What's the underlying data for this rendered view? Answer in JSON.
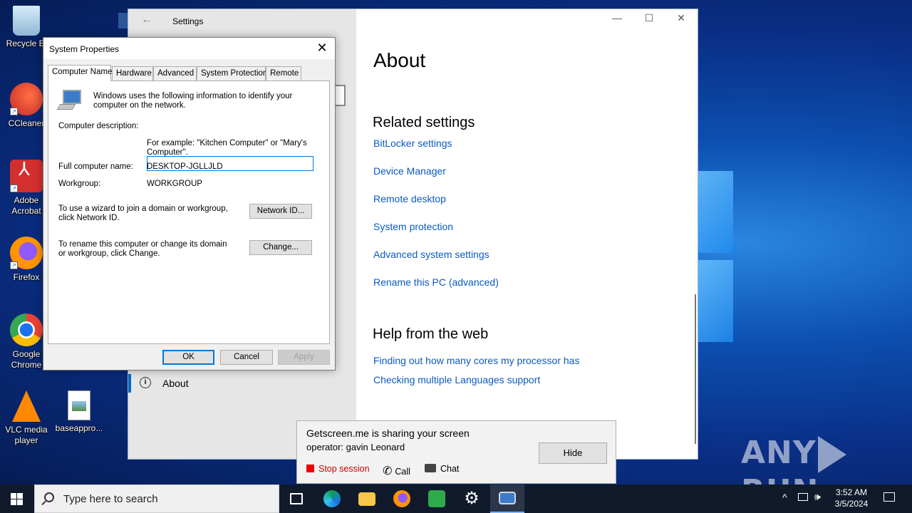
{
  "desktop": {
    "icons": [
      {
        "label": "Recycle Bi",
        "icon": "recycle-bin-icon"
      },
      {
        "label": "CCleaner",
        "icon": "ccleaner-icon"
      },
      {
        "label": "Adobe Acrobat",
        "icon": "adobe-acrobat-icon"
      },
      {
        "label": "Firefox",
        "icon": "firefox-icon"
      },
      {
        "label": "Google Chrome",
        "icon": "chrome-icon"
      },
      {
        "label": "VLC media player",
        "icon": "vlc-icon"
      },
      {
        "label": "baseappro...",
        "icon": "image-file-icon"
      }
    ],
    "watermark": "ANY RUN"
  },
  "settings": {
    "title": "Settings",
    "heading": "About",
    "related_heading": "Related settings",
    "related_links": [
      "BitLocker settings",
      "Device Manager",
      "Remote desktop",
      "System protection",
      "Advanced system settings",
      "Rename this PC (advanced)"
    ],
    "help_heading": "Help from the web",
    "help_links": [
      "Finding out how many cores my processor has",
      "Checking multiple Languages support"
    ],
    "nav_about": "About"
  },
  "sysprop": {
    "title": "System Properties",
    "tabs": [
      "Computer Name",
      "Hardware",
      "Advanced",
      "System Protection",
      "Remote"
    ],
    "intro": "Windows uses the following information to identify your computer on the network.",
    "desc_label": "Computer description:",
    "desc_value": "",
    "example": "For example: \"Kitchen Computer\" or \"Mary's Computer\".",
    "full_name_label": "Full computer name:",
    "full_name_value": "DESKTOP-JGLLJLD",
    "workgroup_label": "Workgroup:",
    "workgroup_value": "WORKGROUP",
    "network_text": "To use a wizard to join a domain or workgroup, click Network ID.",
    "network_btn": "Network ID...",
    "rename_text": "To rename this computer or change its domain or workgroup, click Change.",
    "change_btn": "Change...",
    "ok": "OK",
    "cancel": "Cancel",
    "apply": "Apply"
  },
  "banner": {
    "line1": "Getscreen.me is sharing your screen",
    "line2": "operator: gavin Leonard",
    "hide": "Hide",
    "stop": "Stop session",
    "call": "Call",
    "chat": "Chat"
  },
  "taskbar": {
    "search_placeholder": "Type here to search",
    "time": "3:52 AM",
    "date": "3/5/2024"
  }
}
